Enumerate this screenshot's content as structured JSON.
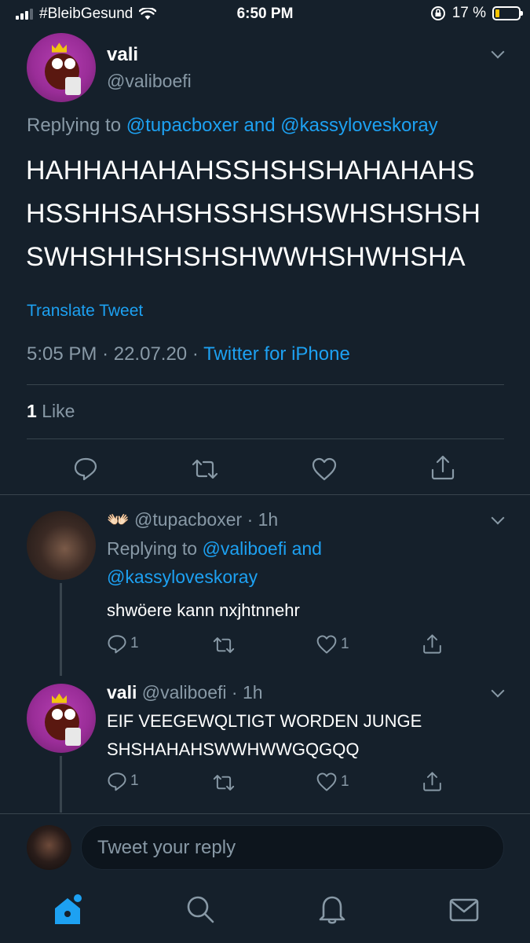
{
  "status_bar": {
    "carrier": "#BleibGesund",
    "time": "6:50 PM",
    "battery": "17 %"
  },
  "main_tweet": {
    "name": "vali",
    "handle": "@valiboefi",
    "replying_prefix": "Replying to",
    "replying_user1": "@tupacboxer",
    "replying_and": "and",
    "replying_user2": "@kassyloveskoray",
    "text_lines": [
      "HAHHAHAHAHSSHSHSHAHAHAHS",
      "HSSHHSAHSHSSHSHSWHSHSHSH",
      "SWHSHHSHSHSHWWHSHWHSHA"
    ],
    "translate": "Translate Tweet",
    "time": "5:05 PM",
    "date": "22.07.20",
    "source": "Twitter for iPhone",
    "like_count": "1",
    "like_label": "Like"
  },
  "replies": [
    {
      "emoji": "👐🏻",
      "handle": "@tupacboxer",
      "age": "1h",
      "replying_prefix": "Replying to",
      "replying_user1": "@valiboefi",
      "replying_and": "and",
      "replying_user2": "@kassyloveskoray",
      "text": "shwöere kann nxjhtnnehr",
      "reply_count": "1",
      "like_count": "1"
    },
    {
      "name": "vali",
      "handle": "@valiboefi",
      "age": "1h",
      "text_lines": [
        "EIF VEEGEWQLTIGT WORDEN JUNGE",
        "SHSHAHAHSWWHWWGQGQQ"
      ],
      "reply_count": "1",
      "like_count": "1"
    }
  ],
  "composer": {
    "placeholder": "Tweet your reply"
  },
  "tabs": [
    "home-icon",
    "search-icon",
    "notifications-icon",
    "messages-icon"
  ],
  "colors": {
    "background": "#15202b",
    "accent": "#1da1f2",
    "muted": "#8899a6"
  }
}
